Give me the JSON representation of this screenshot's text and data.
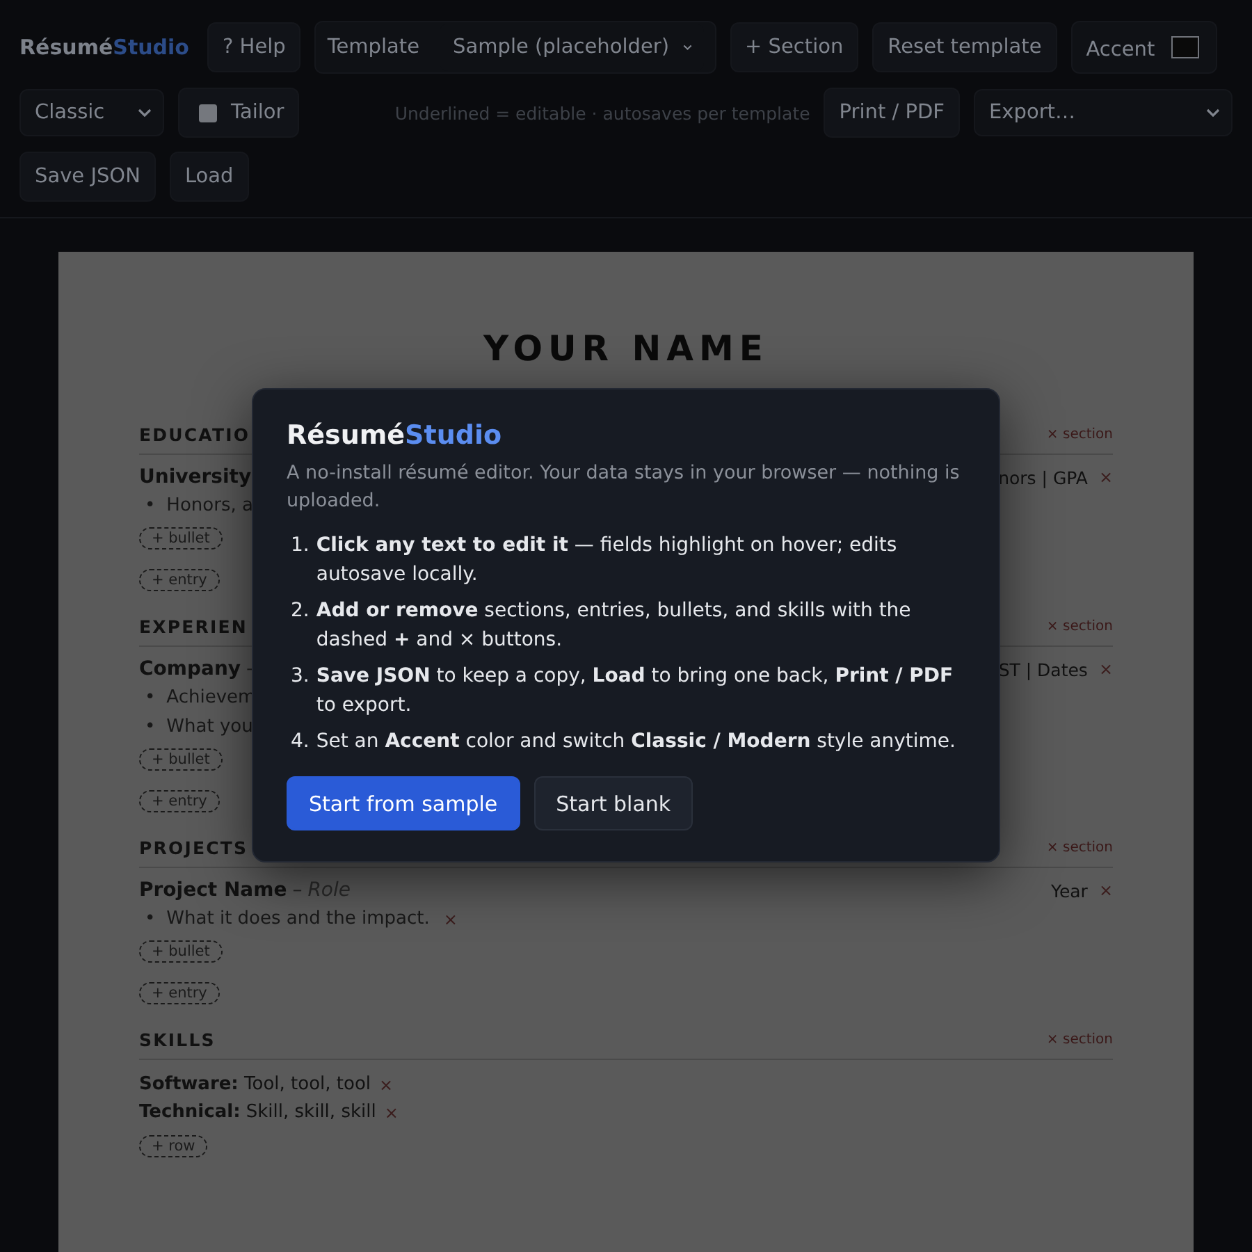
{
  "toolbar": {
    "brand": {
      "first": "Résumé",
      "second": "Studio"
    },
    "row1": [
      {
        "kind": "button",
        "label": "? Help"
      },
      {
        "kind": "group",
        "label": "Template",
        "select": "Sample (placeholder)"
      },
      {
        "kind": "button",
        "label": "+ Section"
      },
      {
        "kind": "button",
        "label": "Reset template"
      },
      {
        "kind": "color",
        "label": "Accent",
        "color": "#0a0a0a"
      }
    ],
    "row2": [
      {
        "kind": "select",
        "label": "Classic"
      },
      {
        "kind": "checkbox",
        "label": "Tailor",
        "checked": false
      },
      {
        "kind": "hint",
        "label": "Underlined = editable · autosaves per template"
      },
      {
        "kind": "button",
        "label": "Print / PDF"
      },
      {
        "kind": "wideselect",
        "label": "Export…"
      }
    ],
    "row3": [
      {
        "kind": "button",
        "label": "Save JSON"
      },
      {
        "kind": "button",
        "label": "Load"
      }
    ]
  },
  "resume": {
    "name": "YOUR NAME",
    "sections": [
      {
        "title": "EDUCATIO",
        "remove": "× section",
        "entries": [
          {
            "title": "University",
            "right": "nors | GPA",
            "remove": "×",
            "bullets": [
              {
                "mark": "•",
                "text": "Honors, a"
              }
            ],
            "add_bullet": "+ bullet"
          }
        ],
        "add_entry": "+ entry"
      },
      {
        "title": "EXPERIEN",
        "remove": "× section",
        "entries": [
          {
            "title": "Company",
            "dash": "–",
            "right": "ST | Dates",
            "remove": "×",
            "bullets": [
              {
                "mark": "•",
                "text": "Achievem"
              },
              {
                "mark": "•",
                "text": "What you"
              }
            ],
            "add_bullet": "+ bullet"
          }
        ],
        "add_entry": "+ entry"
      },
      {
        "title": "PROJECTS",
        "remove": "× section",
        "entries": [
          {
            "title": "Project Name",
            "dash": "–",
            "role": "Role",
            "right": "Year",
            "remove": "×",
            "bullets": [
              {
                "mark": "•",
                "text": "What it does and the impact.",
                "remove": "×"
              }
            ],
            "add_bullet": "+ bullet"
          }
        ],
        "add_entry": "+ entry"
      },
      {
        "title": "SKILLS",
        "remove": "× section",
        "skills": [
          {
            "label": "Software:",
            "value": "Tool, tool, tool",
            "remove": "×"
          },
          {
            "label": "Technical:",
            "value": "Skill, skill, skill",
            "remove": "×"
          }
        ],
        "add_row": "+ row"
      }
    ]
  },
  "modal": {
    "brand": {
      "first": "Résumé",
      "second": "Studio"
    },
    "subtitle": "A no-install résumé editor. Your data stays in your browser — nothing is uploaded.",
    "steps": [
      {
        "number": "1.",
        "text": "**Click any text to edit it** — fields highlight on hover; edits autosave locally."
      },
      {
        "number": "2.",
        "text": "**Add or remove** sections, entries, bullets, and skills with the dashed **+** and × buttons."
      },
      {
        "number": "3.",
        "text": "**Save JSON** to keep a copy, **Load** to bring one back, **Print / PDF** to export."
      },
      {
        "number": "4.",
        "text": "Set an **Accent** color and switch **Classic / Modern** style anytime."
      }
    ],
    "buttons": [
      {
        "kind": "primary",
        "label": "Start from sample"
      },
      {
        "kind": "secondary",
        "label": "Start blank"
      }
    ]
  }
}
